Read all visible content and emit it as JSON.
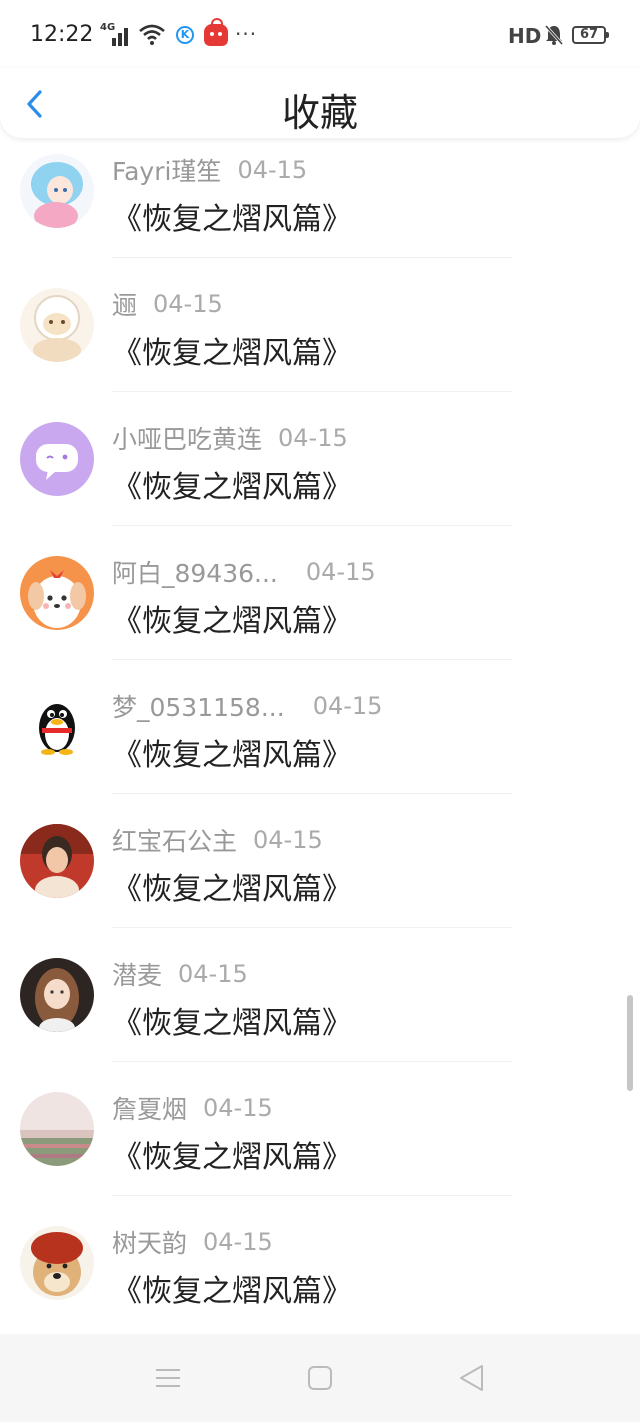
{
  "status_bar": {
    "time": "12:22",
    "network": "4G",
    "hd": "HD",
    "battery": "67"
  },
  "header": {
    "title": "收藏"
  },
  "items": [
    {
      "name": "Fayri瑾笙",
      "date": "04-15",
      "content": "《恢复之熠风篇》",
      "avatar": "anime-girl-blue-hair"
    },
    {
      "name": "逦",
      "date": "04-15",
      "content": "《恢复之熠风篇》",
      "avatar": "cartoon-sheep"
    },
    {
      "name": "小哑巴吃黄连",
      "date": "04-15",
      "content": "《恢复之熠风篇》",
      "avatar": "purple-chat-bubble"
    },
    {
      "name": "阿白_89436...",
      "date": "04-15",
      "content": "《恢复之熠风篇》",
      "avatar": "cartoon-dog-orange"
    },
    {
      "name": "梦_0531158...",
      "date": "04-15",
      "content": "《恢复之熠风篇》",
      "avatar": "qq-penguin"
    },
    {
      "name": "红宝石公主",
      "date": "04-15",
      "content": "《恢复之熠风篇》",
      "avatar": "woman-photo-red"
    },
    {
      "name": "潜麦",
      "date": "04-15",
      "content": "《恢复之熠风篇》",
      "avatar": "girl-photo-brown-hair"
    },
    {
      "name": "詹夏烟",
      "date": "04-15",
      "content": "《恢复之熠风篇》",
      "avatar": "field-landscape"
    },
    {
      "name": "树天韵",
      "date": "04-15",
      "content": "《恢复之熠风篇》",
      "avatar": "doge-red-hair"
    }
  ],
  "nav": [
    "menu-icon",
    "home-square-icon",
    "back-triangle-icon"
  ],
  "colors": {
    "accent": "#2a8ee8",
    "name_gray": "#999999",
    "content_text": "#222222"
  }
}
